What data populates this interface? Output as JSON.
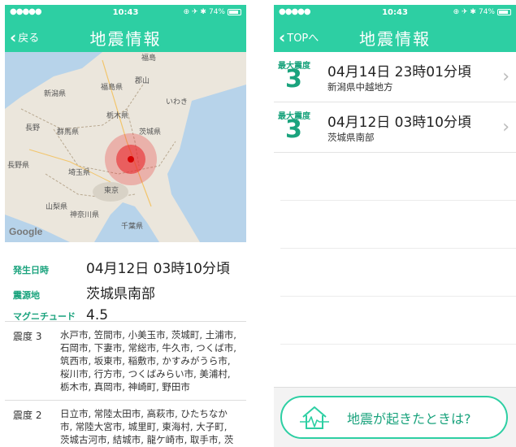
{
  "status_bar": {
    "signal": "●●●●●",
    "time": "10:43",
    "right_icons": "⊕ ✈ ✱",
    "battery": "74%"
  },
  "left_screen": {
    "nav": {
      "back_label": "戻る",
      "title": "地震情報"
    },
    "map": {
      "place_labels": [
        "福島",
        "郡山",
        "新潟県",
        "福島県",
        "いわき",
        "長野",
        "群馬県",
        "栃木県",
        "茨城県",
        "長野県",
        "埼玉県",
        "東京",
        "山梨県",
        "神奈川県",
        "千葉県"
      ],
      "attribution": "Google",
      "epicenter_color": "#e8262c"
    },
    "info": {
      "occurred_key": "発生日時",
      "occurred_value": "04月12日 03時10分頃",
      "epicenter_key": "震源地",
      "epicenter_value": "茨城県南部",
      "magnitude_key": "マグニチュード",
      "magnitude_value": "4.5"
    },
    "intensities": [
      {
        "level": "震度 3",
        "cities": "水戸市, 笠間市, 小美玉市, 茨城町, 土浦市, 石岡市, 下妻市, 常総市, 牛久市, つくば市, 筑西市, 坂東市, 稲敷市, かすみがうら市, 桜川市, 行方市, つくばみらい市, 美浦村, 栃木市, 真岡市, 神崎町, 野田市"
      },
      {
        "level": "震度 2",
        "cities": "日立市, 常陸太田市, 高萩市, ひたちなか市, 常陸大宮市, 城里町, 東海村, 大子町, 茨城古河市, 結城市, 龍ケ崎市, 取手市, 茨城鹿嶋市, 潮来市, 守谷市, 鉾田市, 鉾"
      }
    ]
  },
  "right_screen": {
    "nav": {
      "back_label": "TOPへ",
      "title": "地震情報"
    },
    "quakes": [
      {
        "max_label": "最大震度",
        "max_value": "3",
        "datetime": "04月14日 23時01分頃",
        "region": "新潟県中越地方"
      },
      {
        "max_label": "最大震度",
        "max_value": "3",
        "datetime": "04月12日 03時10分頃",
        "region": "茨城県南部"
      }
    ],
    "help_button_label": "地震が起きたときは?"
  },
  "colors": {
    "accent": "#2dcfa3",
    "accent_dark": "#1aa37d",
    "epicenter": "#e8262c"
  }
}
